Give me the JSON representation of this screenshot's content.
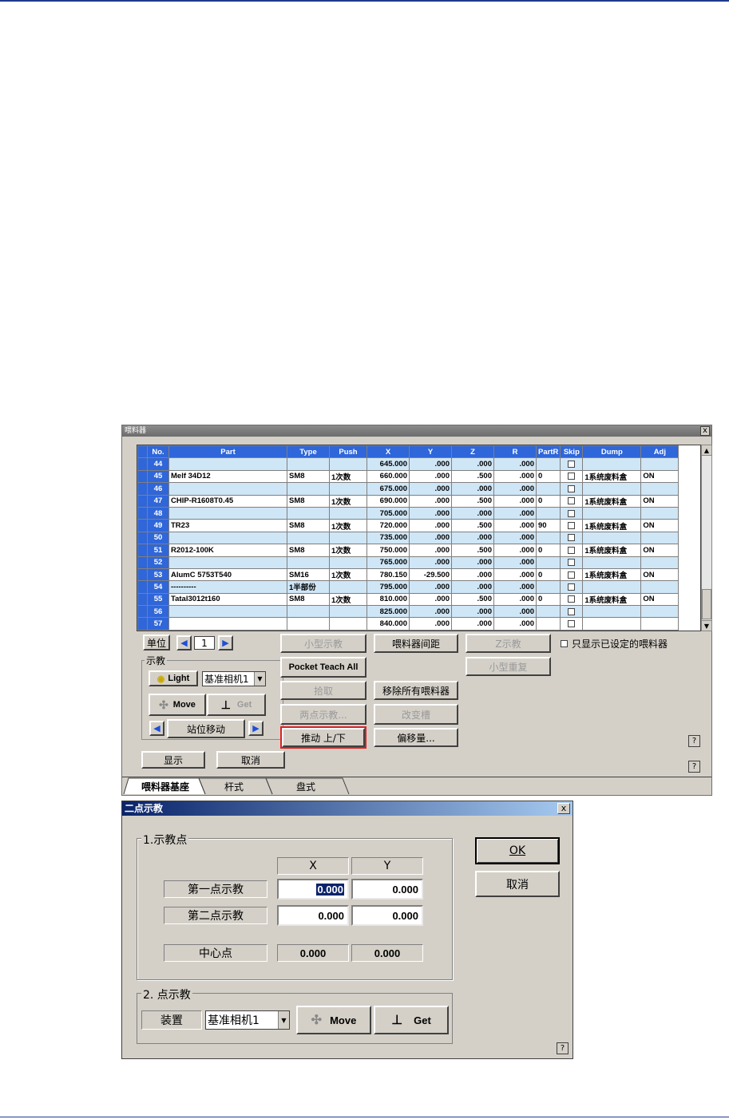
{
  "feeder_window": {
    "title": "喂料器",
    "close": "x",
    "columns": [
      "No.",
      "Part",
      "Type",
      "Push",
      "X",
      "Y",
      "Z",
      "R",
      "PartR",
      "Skip",
      "Dump",
      "Adj"
    ],
    "rows": [
      {
        "no": "44",
        "part": "",
        "type": "",
        "push": "",
        "x": "645.000",
        "y": ".000",
        "z": ".000",
        "r": ".000",
        "partr": "",
        "dump": "",
        "adj": ""
      },
      {
        "no": "45",
        "part": "Melf 34D12",
        "type": "SM8",
        "push": "1次数",
        "x": "660.000",
        "y": ".000",
        "z": ".500",
        "r": ".000",
        "partr": "0",
        "dump": "1系统废料盒",
        "adj": "ON"
      },
      {
        "no": "46",
        "part": "",
        "type": "",
        "push": "",
        "x": "675.000",
        "y": ".000",
        "z": ".000",
        "r": ".000",
        "partr": "",
        "dump": "",
        "adj": ""
      },
      {
        "no": "47",
        "part": "CHIP-R1608T0.45",
        "type": "SM8",
        "push": "1次数",
        "x": "690.000",
        "y": ".000",
        "z": ".500",
        "r": ".000",
        "partr": "0",
        "dump": "1系统废料盒",
        "adj": "ON"
      },
      {
        "no": "48",
        "part": "",
        "type": "",
        "push": "",
        "x": "705.000",
        "y": ".000",
        "z": ".000",
        "r": ".000",
        "partr": "",
        "dump": "",
        "adj": ""
      },
      {
        "no": "49",
        "part": "TR23",
        "type": "SM8",
        "push": "1次数",
        "x": "720.000",
        "y": ".000",
        "z": ".500",
        "r": ".000",
        "partr": "90",
        "dump": "1系统废料盒",
        "adj": "ON"
      },
      {
        "no": "50",
        "part": "",
        "type": "",
        "push": "",
        "x": "735.000",
        "y": ".000",
        "z": ".000",
        "r": ".000",
        "partr": "",
        "dump": "",
        "adj": ""
      },
      {
        "no": "51",
        "part": "R2012-100K",
        "type": "SM8",
        "push": "1次数",
        "x": "750.000",
        "y": ".000",
        "z": ".500",
        "r": ".000",
        "partr": "0",
        "dump": "1系统废料盒",
        "adj": "ON"
      },
      {
        "no": "52",
        "part": "",
        "type": "",
        "push": "",
        "x": "765.000",
        "y": ".000",
        "z": ".000",
        "r": ".000",
        "partr": "",
        "dump": "",
        "adj": ""
      },
      {
        "no": "53",
        "part": "AlumC 5753T540",
        "type": "SM16",
        "push": "1次数",
        "x": "780.150",
        "y": "-29.500",
        "z": ".000",
        "r": ".000",
        "partr": "0",
        "dump": "1系统废料盒",
        "adj": "ON"
      },
      {
        "no": "54",
        "part": "----------",
        "type": "1半部份",
        "push": "",
        "x": "795.000",
        "y": ".000",
        "z": ".000",
        "r": ".000",
        "partr": "",
        "dump": "",
        "adj": ""
      },
      {
        "no": "55",
        "part": "Tatal3012t160",
        "type": "SM8",
        "push": "1次数",
        "x": "810.000",
        "y": ".000",
        "z": ".500",
        "r": ".000",
        "partr": "0",
        "dump": "1系统废料盒",
        "adj": "ON"
      },
      {
        "no": "56",
        "part": "",
        "type": "",
        "push": "",
        "x": "825.000",
        "y": ".000",
        "z": ".000",
        "r": ".000",
        "partr": "",
        "dump": "",
        "adj": ""
      },
      {
        "no": "57",
        "part": "",
        "type": "",
        "push": "",
        "x": "840.000",
        "y": ".000",
        "z": ".000",
        "r": ".000",
        "partr": "",
        "dump": "",
        "adj": ""
      }
    ],
    "unit_label": "单位",
    "unit_value": "1",
    "teach_group": "示教",
    "light_label": "Light",
    "camera_select": "基准相机1",
    "move_label": "Move",
    "get_label": "Get",
    "station_move": "站位移动",
    "show_button": "显示",
    "cancel_button": "取消",
    "btn_small_teach": "小型示教",
    "btn_pocket_teach_all": "Pocket Teach All",
    "btn_pickup": "拾取",
    "btn_two_point": "两点示教...",
    "btn_push_updown": "推动 上/下",
    "btn_feeder_pitch": "喂料器间距",
    "btn_remove_all": "移除所有喂料器",
    "btn_change_slot": "改变槽",
    "btn_offset": "偏移量...",
    "btn_z_teach": "Z示教",
    "btn_small_repeat": "小型重复",
    "only_show_label": "只显示已设定的喂料器",
    "help": "?",
    "tabs": [
      "喂料器基座",
      "杆式",
      "盘式"
    ]
  },
  "two_point_dialog": {
    "title": "二点示教",
    "close": "x",
    "group1_title": "1.示教点",
    "col_x": "X",
    "col_y": "Y",
    "first_point_label": "第一点示教",
    "first_x": "0.000",
    "first_y": "0.000",
    "second_point_label": "第二点示教",
    "second_x": "0.000",
    "second_y": "0.000",
    "center_label": "中心点",
    "center_x": "0.000",
    "center_y": "0.000",
    "group2_title": "2. 点示教",
    "device_label": "装置",
    "device_select": "基准相机1",
    "move_label": "Move",
    "get_label": "Get",
    "ok_label": "OK",
    "cancel_label": "取消",
    "help": "?"
  }
}
